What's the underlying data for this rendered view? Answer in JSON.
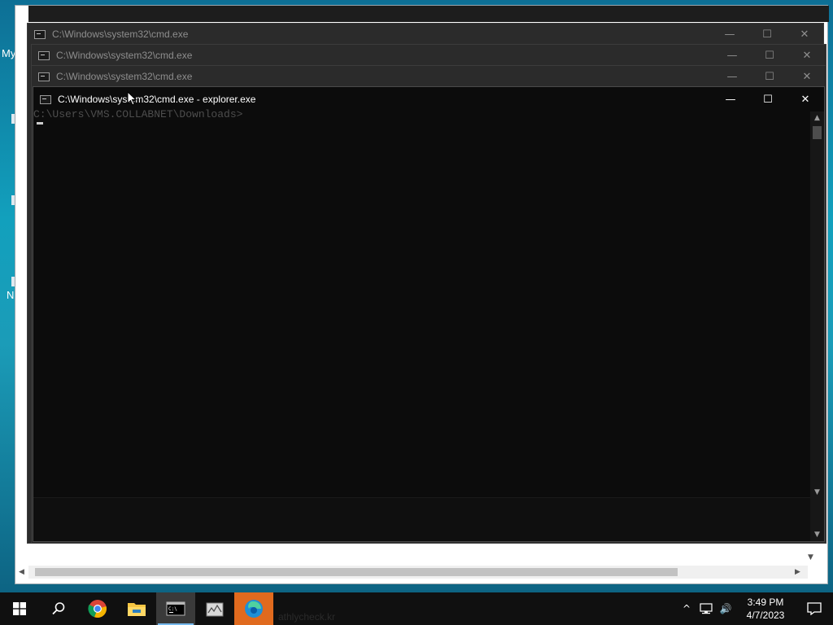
{
  "desktop": {
    "label_fragment": "My",
    "label_fragment2": "N"
  },
  "windows": [
    {
      "title": "C:\\Windows\\system32\\cmd.exe"
    },
    {
      "title": "C:\\Windows\\system32\\cmd.exe"
    },
    {
      "title": "C:\\Windows\\system32\\cmd.exe"
    }
  ],
  "active_window": {
    "title": "C:\\Windows\\system32\\cmd.exe - explorer.exe",
    "ghost_text": "C:\\Users\\VMS.COLLABNET\\Downloads>"
  },
  "title_buttons": {
    "minimize": "—",
    "maximize": "☐",
    "close": "✕"
  },
  "taskbar": {
    "ghost_text": "athlycheck.kr",
    "clock_time": "3:49 PM",
    "clock_date": "4/7/2023",
    "tray_chevron": "^",
    "volume": "🔊"
  },
  "colors": {
    "taskbar": "#101010",
    "console_bg": "#0c0c0c",
    "accent": "#76b9ed",
    "highlight": "#e06a1e"
  }
}
